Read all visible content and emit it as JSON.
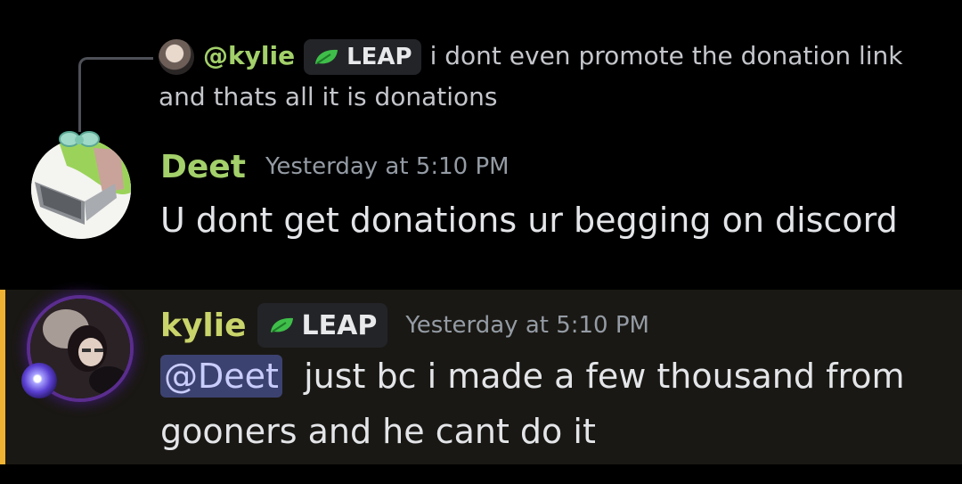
{
  "reply": {
    "author": "@kylie",
    "tag": "LEAP",
    "text": "i dont even promote the donation link and thats all it is  donations"
  },
  "messages": [
    {
      "author": "Deet",
      "timestamp": "Yesterday at 5:10 PM",
      "text": "U dont get donations ur begging on discord",
      "avatar_icon": "laptop-avatar-with-bow"
    },
    {
      "author": "kylie",
      "tag": "LEAP",
      "timestamp": "Yesterday at 5:10 PM",
      "mention": "@Deet",
      "text": "just bc i made a few thousand from gooners and he cant do it",
      "avatar_icon": "photo-avatar-with-orb-decoration"
    }
  ],
  "colors": {
    "background": "#000000",
    "highlight_bar": "#f0b232",
    "highlight_bg": "#1a1814",
    "username_green": "#a3d06a",
    "mention_bg": "#3c4270",
    "tag_bg": "#232428"
  },
  "icons": {
    "tag_icon": "leaf-icon"
  }
}
